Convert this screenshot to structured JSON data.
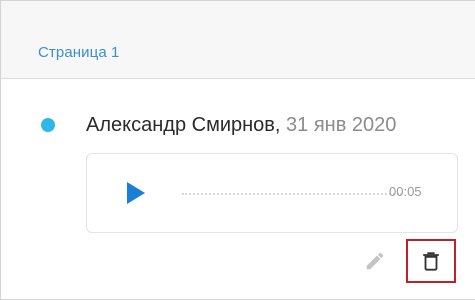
{
  "page": {
    "title": "Страница 1"
  },
  "entry": {
    "author": "Александр Смирнов,",
    "date": "31 янв 2020",
    "status_color": "#2fb8e6",
    "audio": {
      "duration": "00:05",
      "play_icon": "play-icon"
    },
    "actions": {
      "edit_icon": "pencil-icon",
      "delete_icon": "trash-icon",
      "highlighted": "delete"
    }
  },
  "colors": {
    "accent": "#3a8fd1",
    "play": "#1a80d4",
    "highlight": "#c0202a"
  }
}
